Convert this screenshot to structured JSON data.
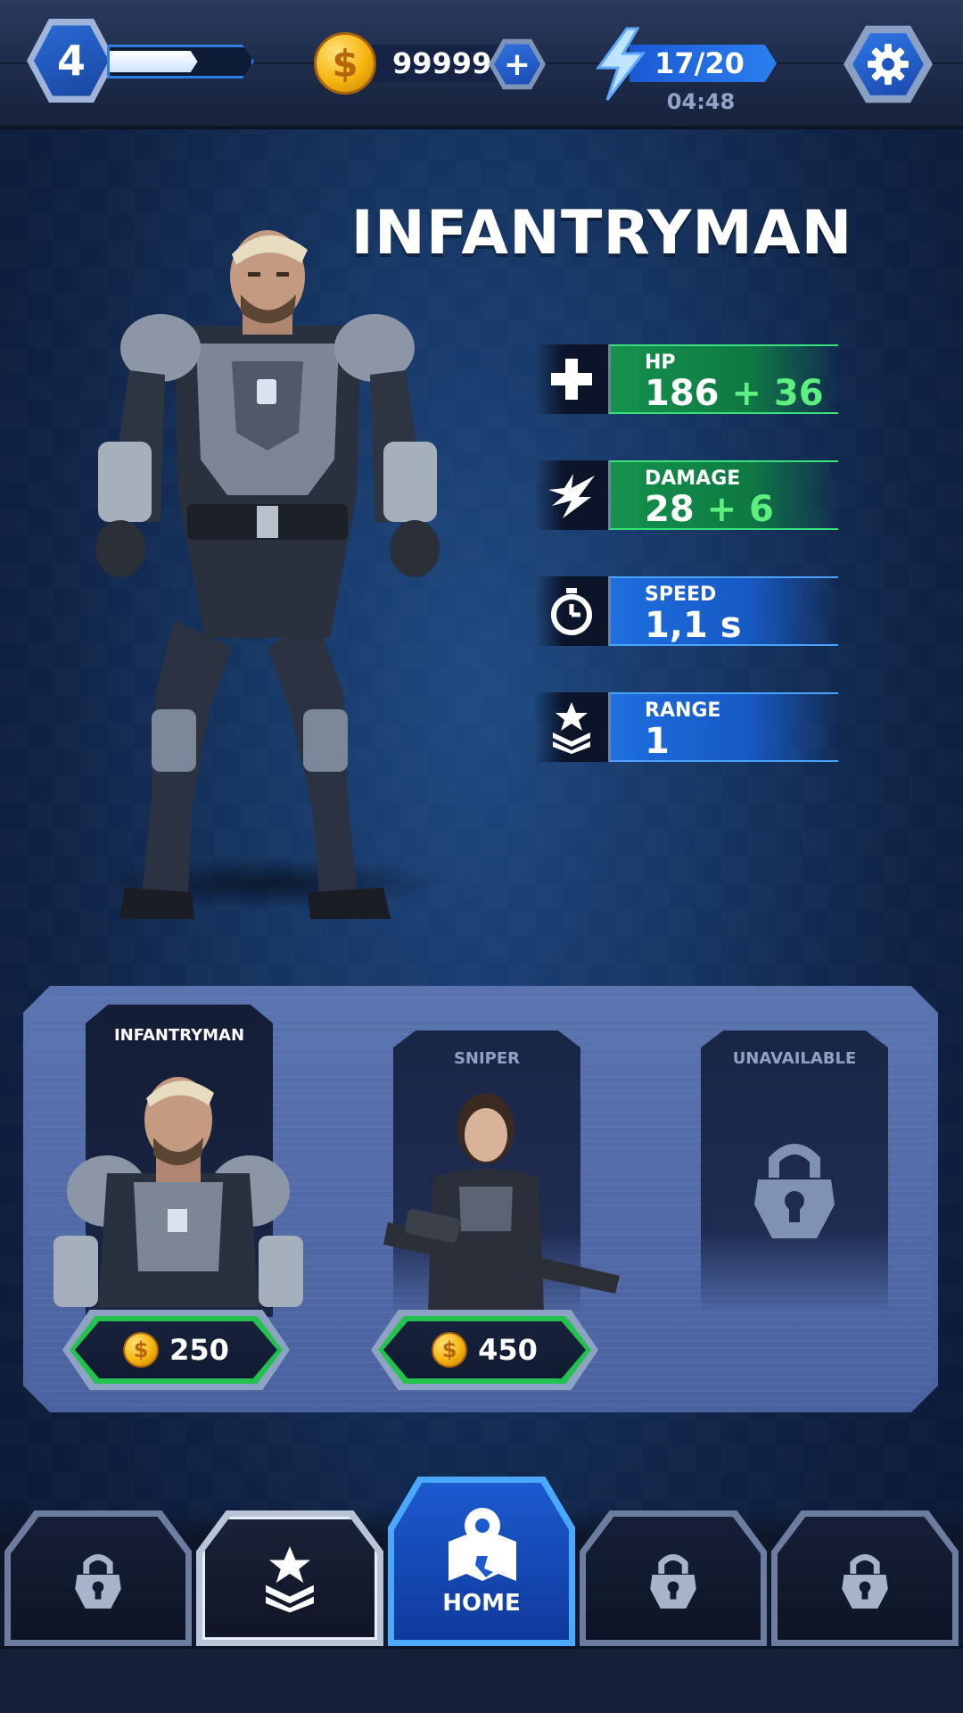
{
  "topbar": {
    "level": "4",
    "xp_progress": 0.62,
    "coins": "99999",
    "energy": "17/20",
    "energy_timer": "04:48"
  },
  "hero": {
    "name": "INFANTRYMAN",
    "stats": [
      {
        "icon": "plus-icon",
        "label": "HP",
        "value": "186",
        "bonus": "+ 36",
        "color": "green"
      },
      {
        "icon": "damage-icon",
        "label": "DAMAGE",
        "value": "28",
        "bonus": "+ 6",
        "color": "green"
      },
      {
        "icon": "stopwatch-icon",
        "label": "SPEED",
        "value": "1,1 s",
        "bonus": "",
        "color": "blue"
      },
      {
        "icon": "rank-icon",
        "label": "RANGE",
        "value": "1",
        "bonus": "",
        "color": "blue"
      }
    ]
  },
  "roster": {
    "units": [
      {
        "title": "INFANTRYMAN",
        "price": "250",
        "state": "selected"
      },
      {
        "title": "SNIPER",
        "price": "450",
        "state": "available"
      },
      {
        "title": "UNAVAILABLE",
        "price": "",
        "state": "locked"
      }
    ]
  },
  "nav": {
    "home_label": "HOME"
  },
  "colors": {
    "stat_green": "#14924d",
    "stat_blue": "#1e6fe0",
    "bonus_green": "#5df07e",
    "price_border_green": "#23c24e",
    "coin_gold": "#f5b40f"
  }
}
